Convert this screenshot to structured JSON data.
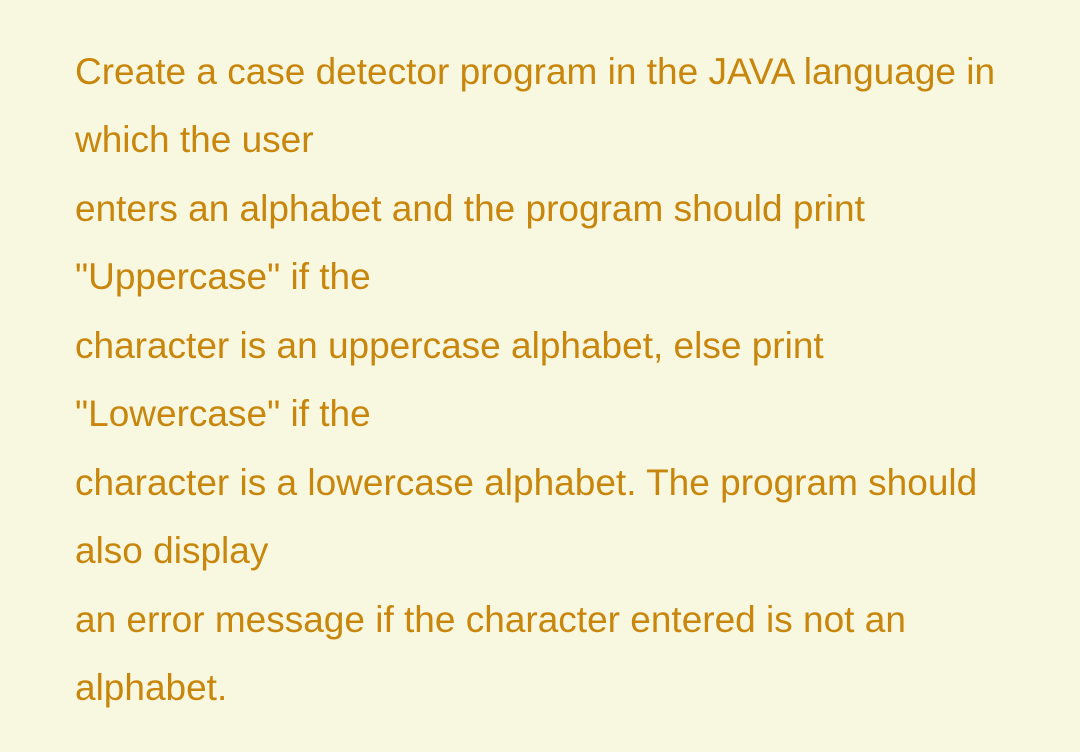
{
  "document": {
    "lines": [
      "Create a case detector program in the JAVA language in which the user",
      "enters an alphabet and the program should print \"Uppercase\" if the",
      "character is an uppercase alphabet, else print \"Lowercase\" if the",
      "character is a lowercase alphabet. The program should also display",
      "an error message if the character entered is not an alphabet."
    ]
  }
}
